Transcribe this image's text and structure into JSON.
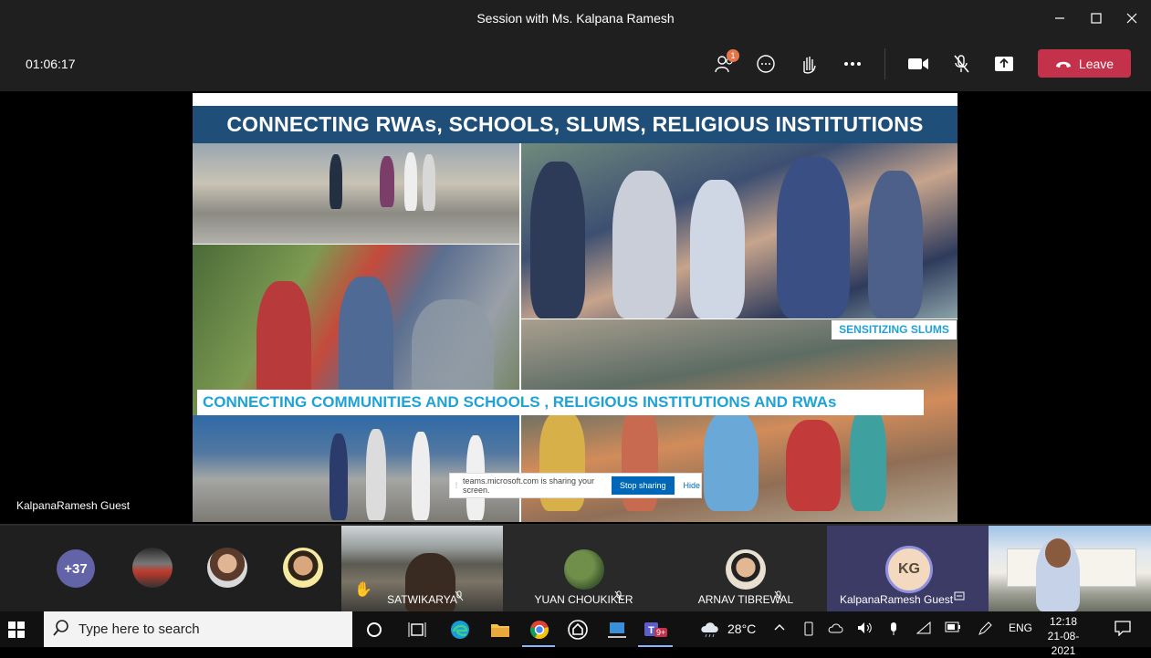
{
  "window": {
    "title": "Session with Ms. Kalpana Ramesh"
  },
  "toolbar": {
    "timer": "01:06:17",
    "participants_badge": "1",
    "leave_label": "Leave"
  },
  "slide": {
    "title": "CONNECTING RWAs, SCHOOLS, SLUMS, RELIGIOUS INSTITUTIONS",
    "caption": "CONNECTING COMMUNITIES AND SCHOOLS , RELIGIOUS INSTITUTIONS AND RWAs",
    "tag": "SENSITIZING SLUMS"
  },
  "share_bar": {
    "message": "teams.microsoft.com is sharing your screen.",
    "stop_label": "Stop sharing",
    "hide_label": "Hide"
  },
  "stage": {
    "presenter_label": "KalpanaRamesh Guest"
  },
  "participants": {
    "overflow_count": "+37",
    "tiles": [
      {
        "name": "SATWIKARYA"
      },
      {
        "name": "YUAN CHOUKIKER"
      },
      {
        "name": "ARNAV TIBREWAL"
      },
      {
        "name": "KalpanaRamesh Guest",
        "initials": "KG"
      }
    ]
  },
  "taskbar": {
    "search_placeholder": "Type here to search",
    "teams_badge": "9+",
    "weather": "28°C",
    "language": "ENG",
    "time": "12:18",
    "date": "21-08-2021"
  },
  "colors": {
    "leave": "#c4314b",
    "slide_banner": "#1f4e79",
    "slide_caption": "#1fa3d6",
    "avatar_overflow": "#6264a7",
    "toolbar_bg": "#1f1f1f"
  }
}
